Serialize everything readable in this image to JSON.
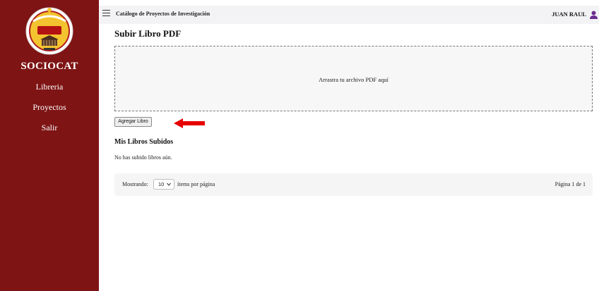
{
  "colors": {
    "sidebar_bg": "#7e1414",
    "topbar_bg": "#f3f3f5",
    "arrow": "#e60000",
    "user_icon": "#6b2d8f"
  },
  "sidebar": {
    "logo_icon": "sociocat-seal-logo",
    "brand": "SOCIOCAT",
    "items": [
      {
        "label": "Libreria"
      },
      {
        "label": "Proyectos"
      },
      {
        "label": "Salir"
      }
    ]
  },
  "topbar": {
    "menu_icon": "hamburger-menu-icon",
    "title": "Catálogo de Proyectos de Investigación",
    "user": "JUAN RAUL",
    "user_icon": "user-icon"
  },
  "upload": {
    "title": "Subir Libro PDF",
    "dropzone_text": "Arrastra tu archivo PDF aquí",
    "button": "Agregar Libro",
    "arrow_icon": "red-left-arrow-icon"
  },
  "books": {
    "title": "Mis Libros Subidos",
    "empty": "No has subido libros aún."
  },
  "pagination": {
    "showing_label": "Mostrando:",
    "per_page": "10",
    "per_page_suffix": "ítems por página",
    "page_info": "Página 1 de 1"
  }
}
